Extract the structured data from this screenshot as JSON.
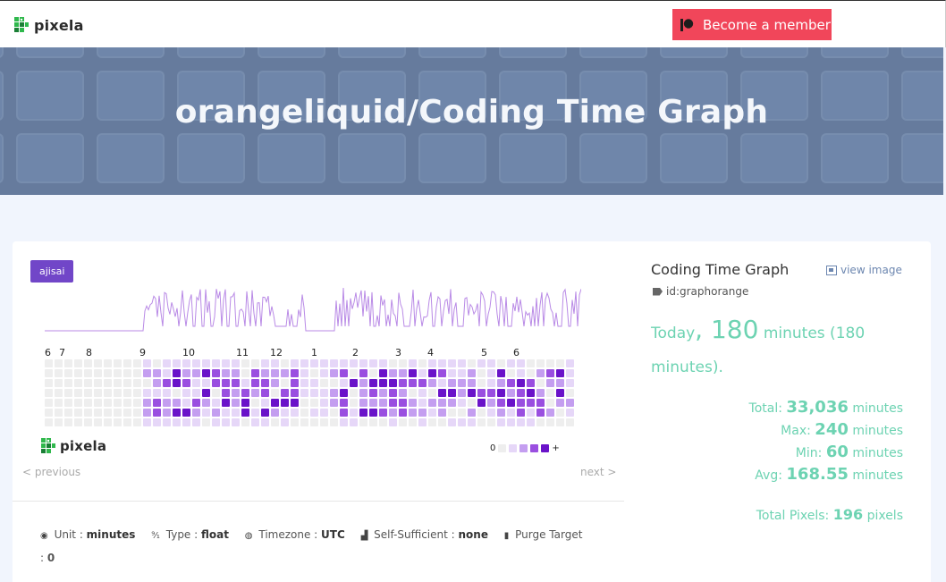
{
  "header": {
    "brand": "pixela",
    "member_button": "Become a member"
  },
  "hero": {
    "title": "orangeliquid/Coding Time Graph"
  },
  "graph": {
    "tag": "ajisai",
    "months": [
      "6",
      "7",
      "8",
      "9",
      "10",
      "11",
      "12",
      "1",
      "2",
      "3",
      "4",
      "5",
      "6"
    ],
    "brand": "pixela",
    "legend_min": "0",
    "legend_max": "+",
    "colors": [
      "#eeeeee",
      "#e6d7f8",
      "#c49ef0",
      "#9a4fe0",
      "#6a13c9"
    ],
    "prev_link": "< previous",
    "next_link": "next >"
  },
  "properties": {
    "unit_label": "Unit",
    "unit_value": "minutes",
    "type_label": "Type",
    "type_value": "float",
    "timezone_label": "Timezone",
    "timezone_value": "UTC",
    "self_sufficient_label": "Self-Sufficient",
    "self_sufficient_value": "none",
    "purge_label": "Purge Target",
    "purge_value": "0"
  },
  "sidebar": {
    "title": "Coding Time Graph",
    "view_image": "view image",
    "id": "id:graphorange",
    "today_label": "Today",
    "today_value": "180",
    "today_unit": "minutes (180 minutes).",
    "total_label": "Total:",
    "total_value": "33,036",
    "max_label": "Max:",
    "max_value": "240",
    "min_label": "Min:",
    "min_value": "60",
    "avg_label": "Avg:",
    "avg_value": "168.55",
    "unit": "minutes",
    "pixels_label": "Total Pixels:",
    "pixels_value": "196",
    "pixels_unit": "pixels"
  }
}
